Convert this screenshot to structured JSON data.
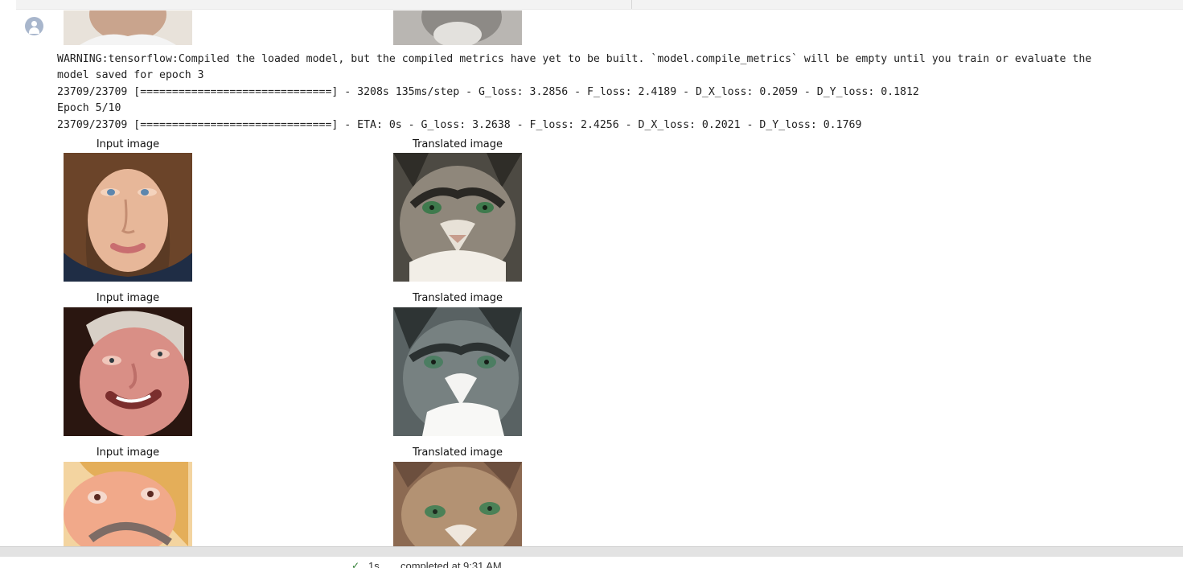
{
  "output_log": {
    "lines": [
      "WARNING:tensorflow:Compiled the loaded model, but the compiled metrics have yet to be built. `model.compile_metrics` will be empty until you train or evaluate the",
      "model saved for epoch 3",
      "23709/23709 [==============================] - 3208s 135ms/step - G_loss: 3.2856 - F_loss: 2.4189 - D_X_loss: 0.2059 - D_Y_loss: 0.1812",
      "Epoch 5/10",
      "23709/23709 [==============================] - ETA: 0s - G_loss: 3.2638 - F_loss: 2.4256 - D_X_loss: 0.2021 - D_Y_loss: 0.1769"
    ]
  },
  "image_grid": {
    "rows": [
      {
        "input_label": "Input image",
        "output_label": "Translated image"
      },
      {
        "input_label": "Input image",
        "output_label": "Translated image"
      },
      {
        "input_label": "Input image",
        "output_label": "Translated image"
      }
    ]
  },
  "status_bar": {
    "check_icon": "✓",
    "duration": "1s",
    "text": "completed at 9:31 AM"
  },
  "colors": {
    "status_check": "#2e7d32",
    "avatar": "#a8b6cc"
  },
  "icons": {
    "avatar": "user-avatar-icon",
    "status": "check-icon"
  }
}
